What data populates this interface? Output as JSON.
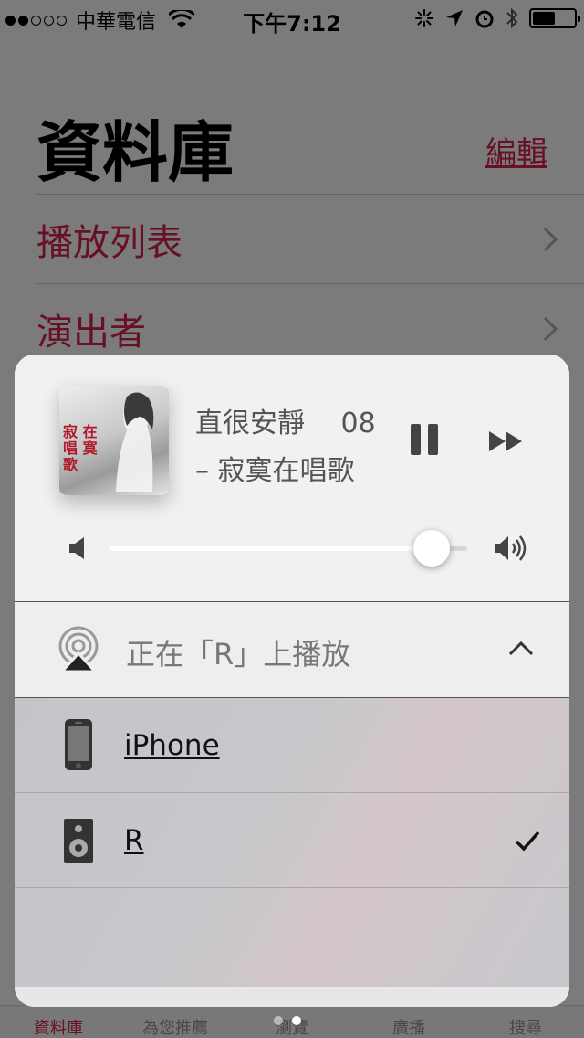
{
  "status_bar": {
    "carrier": "中華電信",
    "time": "下午7:12"
  },
  "library": {
    "title": "資料庫",
    "edit_label": "編輯",
    "rows": [
      {
        "label": "播放列表"
      },
      {
        "label": "演出者"
      }
    ]
  },
  "tabbar": {
    "tabs": [
      {
        "label": "資料庫"
      },
      {
        "label": "為您推薦"
      },
      {
        "label": "瀏覽"
      },
      {
        "label": "廣播"
      },
      {
        "label": "搜尋"
      }
    ]
  },
  "now_playing": {
    "line1": "直很安靜　 08",
    "line2": "– 寂寞在唱歌",
    "artwork_text": "寂 在唱 寞 歌",
    "volume": 0.9
  },
  "airplay": {
    "header_label": "正在「R」上播放",
    "devices": [
      {
        "label": "iPhone",
        "icon": "iphone-icon",
        "selected": false
      },
      {
        "label": "R",
        "icon": "speaker-icon",
        "selected": true
      }
    ]
  },
  "colors": {
    "accent": "#d0214a",
    "sheet_bg": "#f1f1f2",
    "device_bg": "#c4c6ca"
  },
  "page_indicator": {
    "count": 2,
    "current": 2
  }
}
